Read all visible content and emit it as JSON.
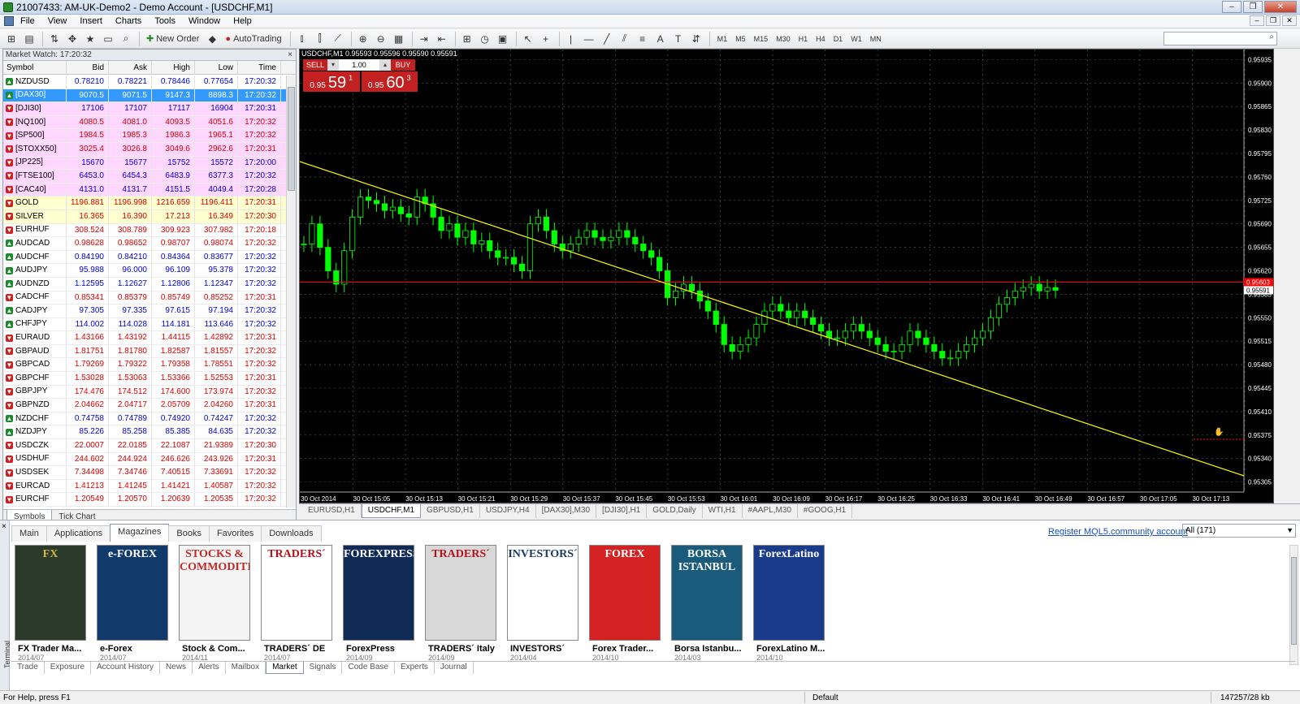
{
  "window": {
    "title": "21007433: AM-UK-Demo2 - Demo Account - [USDCHF,M1]"
  },
  "menu": [
    "File",
    "View",
    "Insert",
    "Charts",
    "Tools",
    "Window",
    "Help"
  ],
  "toolbar": {
    "new_order": "New Order",
    "autotrading": "AutoTrading",
    "timeframes": [
      "M1",
      "M5",
      "M15",
      "M30",
      "H1",
      "H4",
      "D1",
      "W1",
      "MN"
    ]
  },
  "market_watch": {
    "title": "Market Watch: 17:20:32",
    "columns": [
      "Symbol",
      "Bid",
      "Ask",
      "High",
      "Low",
      "Time"
    ],
    "rows": [
      {
        "symbol": "NZDUSD",
        "bid": "0.78210",
        "ask": "0.78221",
        "high": "0.78446",
        "low": "0.77654",
        "time": "17:20:32",
        "dir": "up",
        "bg": "white",
        "color": "blue"
      },
      {
        "symbol": "[DAX30]",
        "bid": "9070.5",
        "ask": "9071.5",
        "high": "9147.3",
        "low": "8898.3",
        "time": "17:20:32",
        "dir": "up",
        "bg": "sel",
        "color": "blue"
      },
      {
        "symbol": "[DJI30]",
        "bid": "17106",
        "ask": "17107",
        "high": "17117",
        "low": "16904",
        "time": "17:20:31",
        "dir": "dn",
        "bg": "pink",
        "color": "blue"
      },
      {
        "symbol": "[NQ100]",
        "bid": "4080.5",
        "ask": "4081.0",
        "high": "4093.5",
        "low": "4051.6",
        "time": "17:20:32",
        "dir": "dn",
        "bg": "pink",
        "color": "red"
      },
      {
        "symbol": "[SP500]",
        "bid": "1984.5",
        "ask": "1985.3",
        "high": "1986.3",
        "low": "1965.1",
        "time": "17:20:32",
        "dir": "dn",
        "bg": "pink",
        "color": "red"
      },
      {
        "symbol": "[STOXX50]",
        "bid": "3025.4",
        "ask": "3026.8",
        "high": "3049.6",
        "low": "2962.6",
        "time": "17:20:31",
        "dir": "dn",
        "bg": "pink",
        "color": "red"
      },
      {
        "symbol": "[JP225]",
        "bid": "15670",
        "ask": "15677",
        "high": "15752",
        "low": "15572",
        "time": "17:20:00",
        "dir": "dn",
        "bg": "pink",
        "color": "blue"
      },
      {
        "symbol": "[FTSE100]",
        "bid": "6453.0",
        "ask": "6454.3",
        "high": "6483.9",
        "low": "6377.3",
        "time": "17:20:32",
        "dir": "dn",
        "bg": "pink",
        "color": "blue"
      },
      {
        "symbol": "[CAC40]",
        "bid": "4131.0",
        "ask": "4131.7",
        "high": "4151.5",
        "low": "4049.4",
        "time": "17:20:28",
        "dir": "dn",
        "bg": "pink",
        "color": "blue"
      },
      {
        "symbol": "GOLD",
        "bid": "1196.881",
        "ask": "1196.998",
        "high": "1216.659",
        "low": "1196.411",
        "time": "17:20:31",
        "dir": "dn",
        "bg": "yellow",
        "color": "red"
      },
      {
        "symbol": "SILVER",
        "bid": "16.365",
        "ask": "16.390",
        "high": "17.213",
        "low": "16.349",
        "time": "17:20:30",
        "dir": "dn",
        "bg": "yellow",
        "color": "red"
      },
      {
        "symbol": "EURHUF",
        "bid": "308.524",
        "ask": "308.789",
        "high": "309.923",
        "low": "307.982",
        "time": "17:20:18",
        "dir": "dn",
        "bg": "white",
        "color": "red"
      },
      {
        "symbol": "AUDCAD",
        "bid": "0.98628",
        "ask": "0.98652",
        "high": "0.98707",
        "low": "0.98074",
        "time": "17:20:32",
        "dir": "up",
        "bg": "white",
        "color": "red"
      },
      {
        "symbol": "AUDCHF",
        "bid": "0.84190",
        "ask": "0.84210",
        "high": "0.84364",
        "low": "0.83677",
        "time": "17:20:32",
        "dir": "up",
        "bg": "white",
        "color": "blue"
      },
      {
        "symbol": "AUDJPY",
        "bid": "95.988",
        "ask": "96.000",
        "high": "96.109",
        "low": "95.378",
        "time": "17:20:32",
        "dir": "up",
        "bg": "white",
        "color": "blue"
      },
      {
        "symbol": "AUDNZD",
        "bid": "1.12595",
        "ask": "1.12627",
        "high": "1.12806",
        "low": "1.12347",
        "time": "17:20:32",
        "dir": "up",
        "bg": "white",
        "color": "blue"
      },
      {
        "symbol": "CADCHF",
        "bid": "0.85341",
        "ask": "0.85379",
        "high": "0.85749",
        "low": "0.85252",
        "time": "17:20:31",
        "dir": "dn",
        "bg": "white",
        "color": "red"
      },
      {
        "symbol": "CADJPY",
        "bid": "97.305",
        "ask": "97.335",
        "high": "97.615",
        "low": "97.194",
        "time": "17:20:32",
        "dir": "up",
        "bg": "white",
        "color": "blue"
      },
      {
        "symbol": "CHFJPY",
        "bid": "114.002",
        "ask": "114.028",
        "high": "114.181",
        "low": "113.646",
        "time": "17:20:32",
        "dir": "up",
        "bg": "white",
        "color": "blue"
      },
      {
        "symbol": "EURAUD",
        "bid": "1.43166",
        "ask": "1.43192",
        "high": "1.44115",
        "low": "1.42892",
        "time": "17:20:31",
        "dir": "dn",
        "bg": "white",
        "color": "red"
      },
      {
        "symbol": "GBPAUD",
        "bid": "1.81751",
        "ask": "1.81780",
        "high": "1.82587",
        "low": "1.81557",
        "time": "17:20:32",
        "dir": "dn",
        "bg": "white",
        "color": "red"
      },
      {
        "symbol": "GBPCAD",
        "bid": "1.79269",
        "ask": "1.79322",
        "high": "1.79358",
        "low": "1.78551",
        "time": "17:20:32",
        "dir": "dn",
        "bg": "white",
        "color": "red"
      },
      {
        "symbol": "GBPCHF",
        "bid": "1.53028",
        "ask": "1.53063",
        "high": "1.53366",
        "low": "1.52553",
        "time": "17:20:31",
        "dir": "dn",
        "bg": "white",
        "color": "red"
      },
      {
        "symbol": "GBPJPY",
        "bid": "174.476",
        "ask": "174.512",
        "high": "174.600",
        "low": "173.974",
        "time": "17:20:32",
        "dir": "dn",
        "bg": "white",
        "color": "red"
      },
      {
        "symbol": "GBPNZD",
        "bid": "2.04662",
        "ask": "2.04717",
        "high": "2.05709",
        "low": "2.04260",
        "time": "17:20:31",
        "dir": "dn",
        "bg": "white",
        "color": "red"
      },
      {
        "symbol": "NZDCHF",
        "bid": "0.74758",
        "ask": "0.74789",
        "high": "0.74920",
        "low": "0.74247",
        "time": "17:20:32",
        "dir": "up",
        "bg": "white",
        "color": "blue"
      },
      {
        "symbol": "NZDJPY",
        "bid": "85.226",
        "ask": "85.258",
        "high": "85.385",
        "low": "84.635",
        "time": "17:20:32",
        "dir": "up",
        "bg": "white",
        "color": "blue"
      },
      {
        "symbol": "USDCZK",
        "bid": "22.0007",
        "ask": "22.0185",
        "high": "22.1087",
        "low": "21.9389",
        "time": "17:20:30",
        "dir": "dn",
        "bg": "white",
        "color": "red"
      },
      {
        "symbol": "USDHUF",
        "bid": "244.602",
        "ask": "244.924",
        "high": "246.626",
        "low": "243.926",
        "time": "17:20:31",
        "dir": "dn",
        "bg": "white",
        "color": "red"
      },
      {
        "symbol": "USDSEK",
        "bid": "7.34498",
        "ask": "7.34746",
        "high": "7.40515",
        "low": "7.33691",
        "time": "17:20:32",
        "dir": "dn",
        "bg": "white",
        "color": "red"
      },
      {
        "symbol": "EURCAD",
        "bid": "1.41213",
        "ask": "1.41245",
        "high": "1.41421",
        "low": "1.40587",
        "time": "17:20:32",
        "dir": "dn",
        "bg": "white",
        "color": "red"
      },
      {
        "symbol": "EURCHF",
        "bid": "1.20549",
        "ask": "1.20570",
        "high": "1.20639",
        "low": "1.20535",
        "time": "17:20:32",
        "dir": "dn",
        "bg": "white",
        "color": "red"
      }
    ],
    "tabs": [
      "Symbols",
      "Tick Chart"
    ]
  },
  "chart": {
    "header": "USDCHF,M1  0.95593 0.95596 0.95590 0.95591",
    "sell_label": "SELL",
    "buy_label": "BUY",
    "volume": "1.00",
    "sell_price": {
      "small": "0.95",
      "big": "59",
      "sup": "1"
    },
    "buy_price": {
      "small": "0.95",
      "big": "60",
      "sup": "3"
    },
    "price_labels": [
      "0.95935",
      "0.95900",
      "0.95865",
      "0.95830",
      "0.95795",
      "0.95760",
      "0.95725",
      "0.95690",
      "0.95655",
      "0.95620",
      "0.95585",
      "0.95550",
      "0.95515",
      "0.95480",
      "0.95445",
      "0.95410",
      "0.95375",
      "0.95340",
      "0.95305"
    ],
    "ask_tag": "0.95603",
    "bid_tag": "0.95591",
    "time_labels": [
      "30 Oct 2014",
      "30 Oct 15:05",
      "30 Oct 15:13",
      "30 Oct 15:21",
      "30 Oct 15:29",
      "30 Oct 15:37",
      "30 Oct 15:45",
      "30 Oct 15:53",
      "30 Oct 16:01",
      "30 Oct 16:09",
      "30 Oct 16:17",
      "30 Oct 16:25",
      "30 Oct 16:33",
      "30 Oct 16:41",
      "30 Oct 16:49",
      "30 Oct 16:57",
      "30 Oct 17:05",
      "30 Oct 17:13"
    ],
    "tabs": [
      "EURUSD,H1",
      "USDCHF,M1",
      "GBPUSD,H1",
      "USDJPY,H4",
      "[DAX30],M30",
      "[DJI30],H1",
      "GOLD,Daily",
      "WTI,H1",
      "#AAPL,M30",
      "#GOOG,H1"
    ],
    "active_tab": "USDCHF,M1",
    "colors": {
      "bg": "#000000",
      "candle": "#00ff00",
      "trendline": "#ffff00",
      "askline": "#ff0000",
      "grid": "#556655"
    }
  },
  "chart_data": {
    "type": "candlestick",
    "title": "USDCHF,M1",
    "ylim": [
      0.9529,
      0.9595
    ],
    "close": [
      0.9566,
      0.9569,
      0.95655,
      0.9562,
      0.956,
      0.9565,
      0.957,
      0.9573,
      0.95725,
      0.9572,
      0.9571,
      0.95715,
      0.95705,
      0.957,
      0.9573,
      0.9572,
      0.957,
      0.9568,
      0.9569,
      0.9567,
      0.9568,
      0.9566,
      0.95665,
      0.9565,
      0.9564,
      0.9564,
      0.9563,
      0.9562,
      0.9569,
      0.957,
      0.9568,
      0.9566,
      0.9565,
      0.9566,
      0.9567,
      0.9568,
      0.9567,
      0.95665,
      0.9567,
      0.9568,
      0.9567,
      0.9566,
      0.9565,
      0.9564,
      0.9562,
      0.9558,
      0.9559,
      0.956,
      0.9559,
      0.95575,
      0.9556,
      0.9554,
      0.9551,
      0.955,
      0.9551,
      0.9552,
      0.9554,
      0.9556,
      0.9557,
      0.9556,
      0.9555,
      0.9556,
      0.9555,
      0.9554,
      0.9553,
      0.9552,
      0.9552,
      0.9553,
      0.9554,
      0.9553,
      0.9552,
      0.9551,
      0.955,
      0.955,
      0.9551,
      0.9553,
      0.9552,
      0.9551,
      0.955,
      0.9549,
      0.9549,
      0.955,
      0.9551,
      0.9552,
      0.9553,
      0.9555,
      0.9557,
      0.9558,
      0.9559,
      0.95595,
      0.956,
      0.9559,
      0.95595,
      0.95591
    ]
  },
  "terminal": {
    "label": "Terminal",
    "nav_tabs": [
      "Main",
      "Applications",
      "Magazines",
      "Books",
      "Favorites",
      "Downloads"
    ],
    "active_nav": "Magazines",
    "register_link": "Register MQL5.community account",
    "filter": "All (171)",
    "magazines": [
      {
        "name": "FX Trader Ma...",
        "date": "2014/07",
        "cover": "#2b3a2a",
        "accent": "#d6b545",
        "mark": "FX"
      },
      {
        "name": "e-Forex",
        "date": "2014/07",
        "cover": "#123a6a",
        "accent": "#ffffff",
        "mark": "e-FOREX"
      },
      {
        "name": "Stock & Com...",
        "date": "2014/11",
        "cover": "#f4f4f4",
        "accent": "#c22a2a",
        "mark": "STOCKS & COMMODITIES"
      },
      {
        "name": "TRADERS´ DE",
        "date": "2014/07",
        "cover": "#ffffff",
        "accent": "#b3121c",
        "mark": "TRADERS´"
      },
      {
        "name": "ForexPress",
        "date": "2014/09",
        "cover": "#0f2a55",
        "accent": "#ffffff",
        "mark": "FOREXPRESS"
      },
      {
        "name": "TRADERS´ Italy",
        "date": "2014/09",
        "cover": "#d8d8d8",
        "accent": "#b3121c",
        "mark": "TRADERS´"
      },
      {
        "name": "INVESTORS´",
        "date": "2014/04",
        "cover": "#ffffff",
        "accent": "#1a3a6a",
        "mark": "INVESTORS´"
      },
      {
        "name": "Forex Trader...",
        "date": "2014/10",
        "cover": "#d42222",
        "accent": "#ffffff",
        "mark": "FOREX"
      },
      {
        "name": "Borsa Istanbu...",
        "date": "2014/03",
        "cover": "#1a5a7a",
        "accent": "#ffffff",
        "mark": "BORSA ISTANBUL"
      },
      {
        "name": "ForexLatino M...",
        "date": "2014/10",
        "cover": "#1a3a8a",
        "accent": "#ffffff",
        "mark": "ForexLatino"
      }
    ],
    "bottom_tabs": [
      "Trade",
      "Exposure",
      "Account History",
      "News",
      "Alerts",
      "Mailbox",
      "Market",
      "Signals",
      "Code Base",
      "Experts",
      "Journal"
    ],
    "active_bottom": "Market"
  },
  "status": {
    "help": "For Help, press F1",
    "profile": "Default",
    "traffic": "147257/28 kb"
  }
}
